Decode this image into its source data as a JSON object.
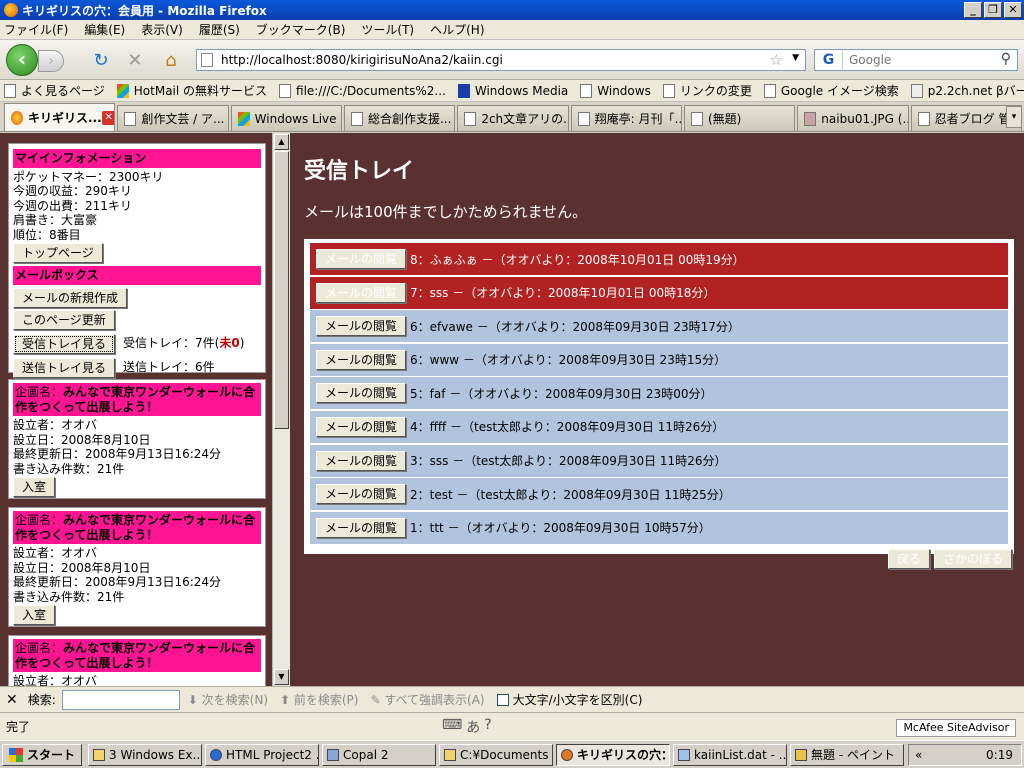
{
  "window": {
    "title": "キリギリスの穴：会員用 - Mozilla Firefox"
  },
  "menu": [
    "ファイル(F)",
    "編集(E)",
    "表示(V)",
    "履歴(S)",
    "ブックマーク(B)",
    "ツール(T)",
    "ヘルプ(H)"
  ],
  "nav": {
    "url": "http://localhost:8080/kirigirisuNoAna2/kaiin.cgi",
    "search_placeholder": "Google",
    "search_engine_glyph": "G"
  },
  "bookmarks": [
    "よく見るページ",
    "HotMail の無料サービス",
    "file:///C:/Documents%2...",
    "Windows Media",
    "Windows",
    "リンクの変更",
    "Google イメージ検索",
    "p2.2ch.net βバージョン"
  ],
  "tabs": [
    {
      "label": "キリギリス...",
      "active": true
    },
    {
      "label": "創作文芸 / ア..."
    },
    {
      "label": "Windows Live ..."
    },
    {
      "label": "総合創作支援..."
    },
    {
      "label": "2ch文章アリの..."
    },
    {
      "label": "翔庵亭: 月刊「..."
    },
    {
      "label": "(無題)"
    },
    {
      "label": "naibu01.JPG (..."
    },
    {
      "label": "忍者ブログ 管..."
    }
  ],
  "sidebar": {
    "info": {
      "heading": "マイインフォメーション",
      "lines": [
        "ポケットマネー：2300キリ",
        "今週の収益：290キリ",
        "今週の出費：211キリ",
        "肩書き：大富豪",
        "順位：8番目"
      ],
      "top_button": "トップページ"
    },
    "mailbox": {
      "heading": "メールボックス",
      "new_button": "メールの新規作成",
      "refresh_button": "このページ更新",
      "inbox_button": "受信トレイ見る",
      "inbox_label": "受信トレイ：7件(",
      "inbox_unread": "未0",
      "inbox_close": ")",
      "outbox_button": "送信トレイ見る",
      "outbox_label": "送信トレイ：6件"
    },
    "projects": [
      {
        "prefix": "企画名：",
        "name": "みんなで東京ワンダーウォールに合作をつくって出展しよう！",
        "founder": "設立者：オオバ",
        "date": "設立日：2008年8月10日",
        "updated": "最終更新日：2008年9月13日16:24分",
        "posts": "書き込み件数：21件",
        "enter": "入室"
      },
      {
        "prefix": "企画名：",
        "name": "みんなで東京ワンダーウォールに合作をつくって出展しよう！",
        "founder": "設立者：オオバ",
        "date": "設立日：2008年8月10日",
        "updated": "最終更新日：2008年9月13日16:24分",
        "posts": "書き込み件数：21件",
        "enter": "入室"
      },
      {
        "prefix": "企画名：",
        "name": "みんなで東京ワンダーウォールに合作をつくって出展しよう！",
        "founder": "設立者：オオバ"
      }
    ]
  },
  "main": {
    "title": "受信トレイ",
    "notice": "メールは100件までしかためられません。",
    "view_button": "メールの閲覧",
    "mails": [
      {
        "text": "8：ふぁふぁ －（オオバより：2008年10月01日 00時19分）",
        "unread": true
      },
      {
        "text": "7：sss －（オオバより：2008年10月01日 00時18分）",
        "unread": true
      },
      {
        "text": "6：efvawe －（オオバより：2008年09月30日 23時17分）",
        "unread": false
      },
      {
        "text": "6：www －（オオバより：2008年09月30日 23時15分）",
        "unread": false
      },
      {
        "text": "5：faf －（オオバより：2008年09月30日 23時00分）",
        "unread": false
      },
      {
        "text": "4：ffff －（test太郎より：2008年09月30日 11時26分）",
        "unread": false
      },
      {
        "text": "3：sss －（test太郎より：2008年09月30日 11時26分）",
        "unread": false
      },
      {
        "text": "2：test －（test太郎より：2008年09月30日 11時25分）",
        "unread": false
      },
      {
        "text": "1：ttt －（オオバより：2008年09月30日 10時57分）",
        "unread": false
      }
    ],
    "back_button": "戻る",
    "up_button": "さかのぼる"
  },
  "findbar": {
    "label": "検索:",
    "next": "次を検索(N)",
    "prev": "前を検索(P)",
    "highlight": "すべて強調表示(A)",
    "matchcase": "大文字/小文字を区別(C)"
  },
  "status": {
    "text": "完了",
    "mcafee": "McAfee SiteAdvisor"
  },
  "taskbar": {
    "start": "スタート",
    "tasks": [
      {
        "label": "3 Windows Ex..."
      },
      {
        "label": "HTML Project2 ..."
      },
      {
        "label": "Copal 2"
      },
      {
        "label": "C:¥Documents ..."
      },
      {
        "label": "キリギリスの穴：...",
        "active": true
      },
      {
        "label": "kaiinList.dat - ..."
      },
      {
        "label": "無題 - ペイント"
      }
    ],
    "clock": "0:19"
  }
}
